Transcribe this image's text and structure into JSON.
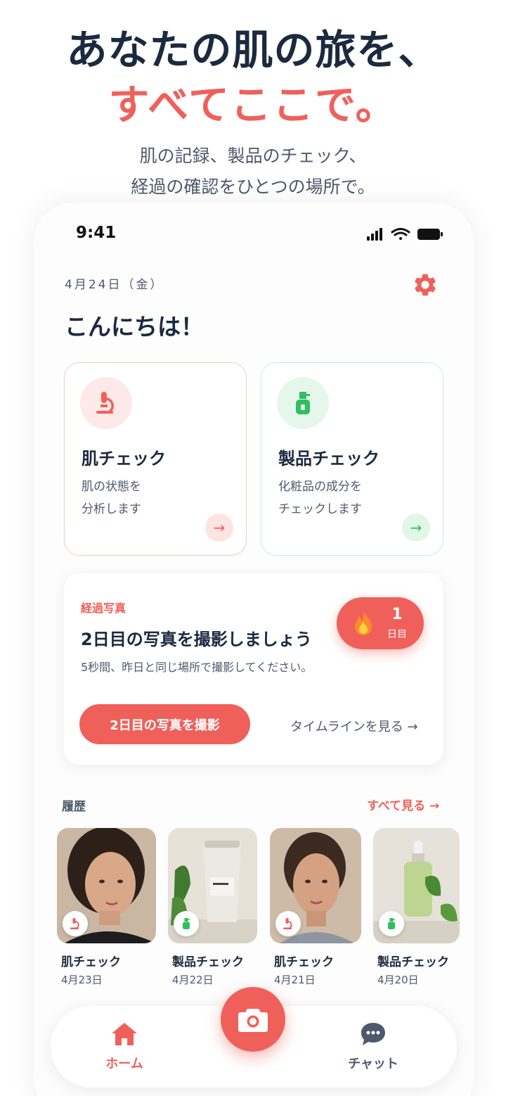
{
  "hero": {
    "title": "あなたの肌の旅を、",
    "accent": "すべてここで。",
    "subtitle_line1": "肌の記録、製品のチェック、",
    "subtitle_line2": "経過の確認をひとつの場所で。"
  },
  "status_bar": {
    "time": "9:41",
    "icons": [
      "signal-icon",
      "wifi-icon",
      "battery-icon"
    ]
  },
  "header": {
    "date": "4月24日（金）",
    "greeting": "こんにちは！",
    "settings_icon": "gear-icon"
  },
  "cards": [
    {
      "title": "肌チェック",
      "desc_line1": "肌の状態を",
      "desc_line2": "分析します",
      "icon": "microscope-icon",
      "accent": "#f0605a"
    },
    {
      "title": "製品チェック",
      "desc_line1": "化粧品の成分を",
      "desc_line2": "チェックします",
      "icon": "bottle-icon",
      "accent": "#2fbf62"
    }
  ],
  "progress": {
    "label": "経過写真",
    "title": "2日目の写真を撮影しましょう",
    "note": "5秒間、昨日と同じ場所で撮影してください。",
    "streak_count": "1",
    "streak_unit": "日目",
    "button": "2日目の写真を撮影",
    "link": "タイムラインを見る →"
  },
  "history": {
    "label": "履歴",
    "see_all": "すべて見る →",
    "items": [
      {
        "title": "肌チェック",
        "date": "4月23日",
        "type": "skin"
      },
      {
        "title": "製品チェック",
        "date": "4月22日",
        "type": "product"
      },
      {
        "title": "肌チェック",
        "date": "4月21日",
        "type": "skin"
      },
      {
        "title": "製品チェック",
        "date": "4月20日",
        "type": "product"
      }
    ]
  },
  "nav": {
    "home": "ホーム",
    "chat": "チャット",
    "camera_icon": "camera-icon"
  },
  "colors": {
    "accent": "#f0605a",
    "green": "#2fbf62",
    "text": "#1b2a3e",
    "muted": "#4d5a6c"
  }
}
